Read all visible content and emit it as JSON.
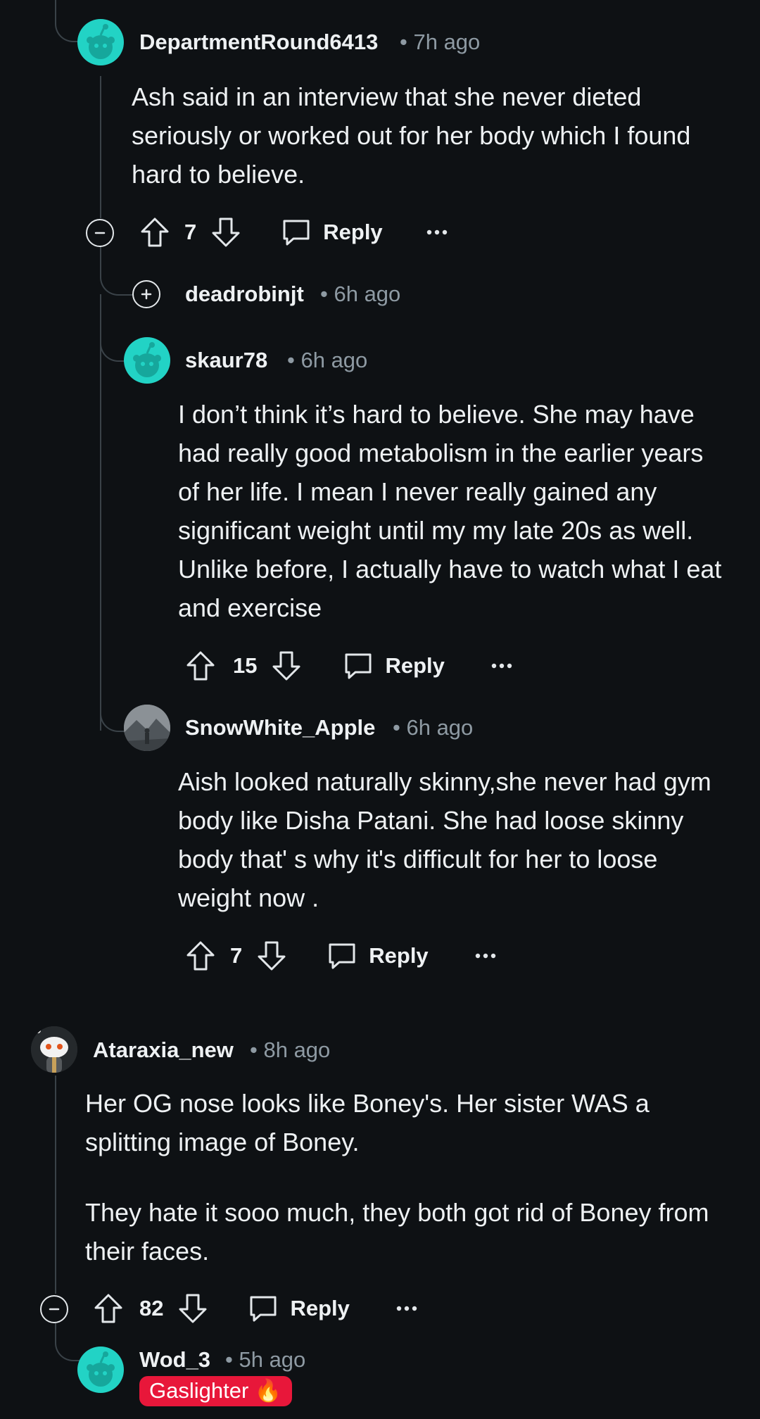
{
  "comments": [
    {
      "username": "DepartmentRound6413",
      "time": "7h ago",
      "body": "Ash said in an interview that she never dieted seriously or worked out for her body which I found hard to believe.",
      "votes": "7",
      "reply_label": "Reply"
    },
    {
      "username": "deadrobinjt",
      "time": "6h ago",
      "collapsed": true
    },
    {
      "username": "skaur78",
      "time": "6h ago",
      "body": "I don’t think it’s hard to believe. She may have had really good metabolism in the earlier years of her life. I mean I never really gained any significant weight until my my late 20s as well. Unlike before, I actually have to watch what I eat and exercise",
      "votes": "15",
      "reply_label": "Reply"
    },
    {
      "username": "SnowWhite_Apple",
      "time": "6h ago",
      "body": "Aish looked naturally skinny,she never had gym body like Disha Patani. She had loose skinny body that' s why it's difficult for her to loose weight now .",
      "votes": "7",
      "reply_label": "Reply"
    },
    {
      "username": "Ataraxia_new",
      "time": "8h ago",
      "body_p1": "Her OG nose looks like Boney's. Her sister WAS a splitting image of Boney.",
      "body_p2": "They hate it sooo much, they both got rid of Boney from their faces.",
      "votes": "82",
      "reply_label": "Reply"
    },
    {
      "username": "Wod_3",
      "time": "5h ago",
      "flair": "Gaslighter 🔥"
    }
  ],
  "colors": {
    "background": "#0e1114",
    "text": "#eef1f3",
    "meta": "#8e9aa3",
    "thread_line": "#3a4248",
    "avatar_teal": "#22d3c5",
    "flair_red": "#e8173a"
  }
}
